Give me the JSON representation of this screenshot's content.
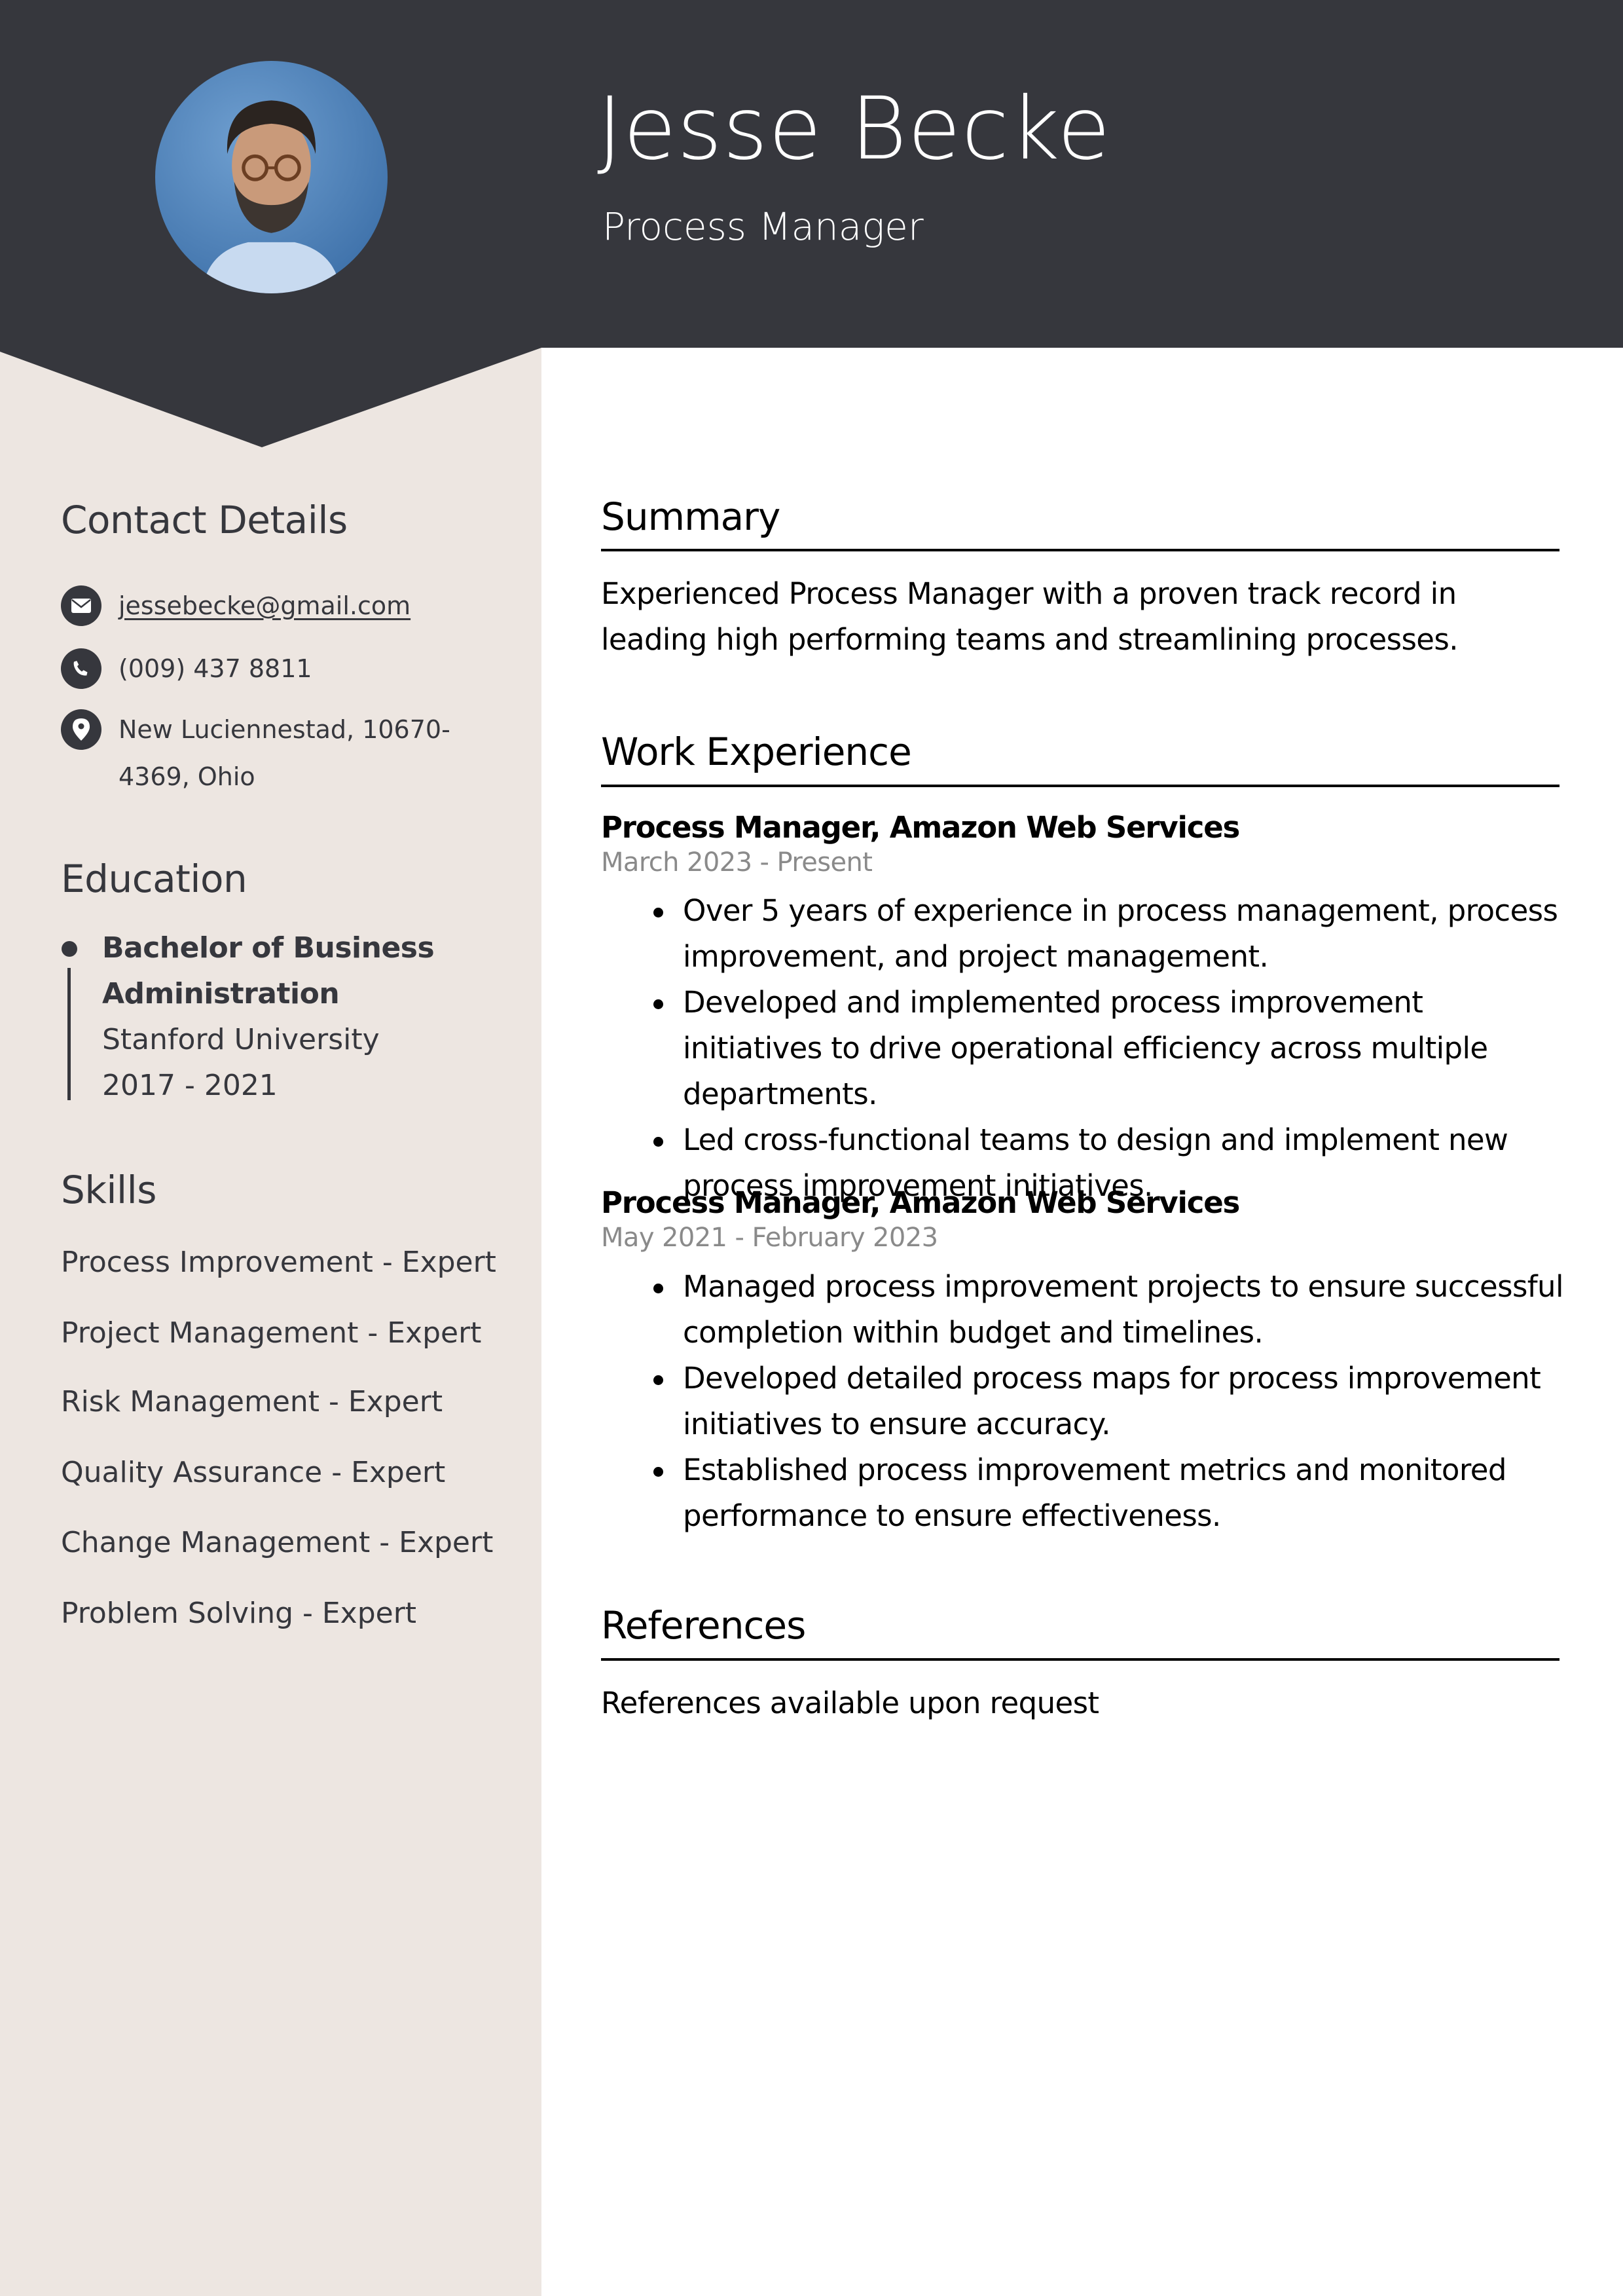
{
  "header": {
    "name": "Jesse Becke",
    "job_title": "Process Manager",
    "photo": "avatar-photo",
    "background_color": "#36373d"
  },
  "sidebar": {
    "background_color": "#ede6e1",
    "contact": {
      "heading": "Contact Details",
      "items": [
        {
          "icon": "envelope-icon",
          "text": "jessebecke@gmail.com"
        },
        {
          "icon": "phone-icon",
          "text": "(009) 437 8811"
        },
        {
          "icon": "map-pin-icon",
          "text": "New Luciennestad, 10670-4369, Ohio"
        }
      ]
    },
    "education": {
      "heading": "Education",
      "degree_line1": "Bachelor of Business",
      "degree_line2": "Administration",
      "school": "Stanford University",
      "years": "2017 - 2021"
    },
    "skills": {
      "heading": "Skills",
      "items": [
        "Process Improvement - Expert",
        "Project Management - Expert",
        "Risk Management - Expert",
        "Quality Assurance - Expert",
        "Change Management - Expert",
        "Problem Solving - Expert"
      ]
    }
  },
  "main": {
    "summary": {
      "heading": "Summary",
      "text": "Experienced Process Manager with a proven track record in leading high performing teams and streamlining processes."
    },
    "experience": {
      "heading": "Work Experience",
      "jobs": [
        {
          "title": "Process Manager, Amazon Web Services",
          "dates": "March 2023 - Present",
          "bullets": [
            "Over 5 years of experience in process management, process improvement, and project management.",
            "Developed and implemented process improvement initiatives to drive operational efficiency across multiple departments.",
            "Led cross-functional teams to design and implement new process improvement initiatives."
          ]
        },
        {
          "title": "Process Manager, Amazon Web Services",
          "dates": "May 2021 - February 2023",
          "bullets": [
            "Managed process improvement projects to ensure successful completion within budget and timelines.",
            "Developed detailed process maps for process improvement initiatives to ensure accuracy.",
            "Established process improvement metrics and monitored performance to ensure effectiveness."
          ]
        }
      ]
    },
    "references": {
      "heading": "References",
      "text": "References available upon request"
    }
  }
}
